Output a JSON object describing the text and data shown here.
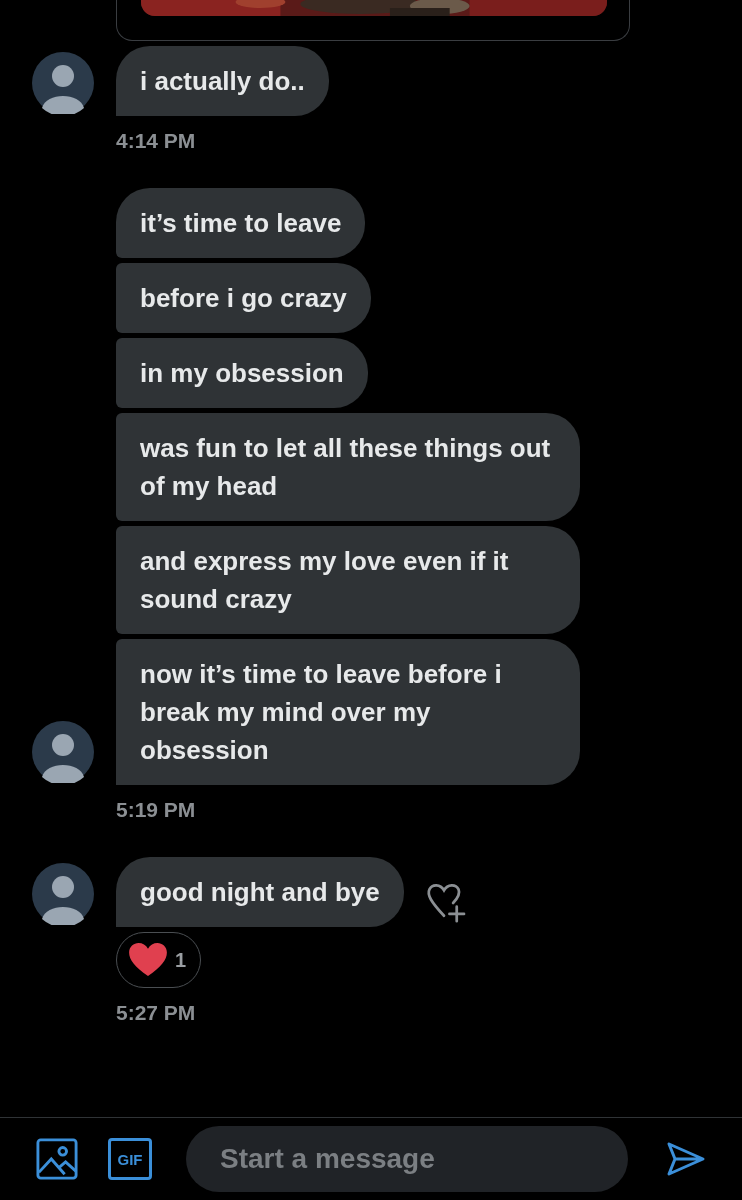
{
  "groups": [
    {
      "messages": [
        "i actually do.."
      ],
      "time": "4:14 PM"
    },
    {
      "messages": [
        "it’s time to leave",
        "before i go crazy",
        "in my obsession",
        "was fun to let all these things out of my head",
        "and express my love even if it sound crazy",
        "now it’s time to leave before i break my mind over my obsession"
      ],
      "time": "5:19 PM"
    },
    {
      "messages": [
        "good night and bye"
      ],
      "reactions": [
        {
          "count": "1"
        }
      ],
      "time": "5:27 PM"
    }
  ],
  "composer": {
    "placeholder": "Start a message",
    "gif_label": "GIF"
  }
}
